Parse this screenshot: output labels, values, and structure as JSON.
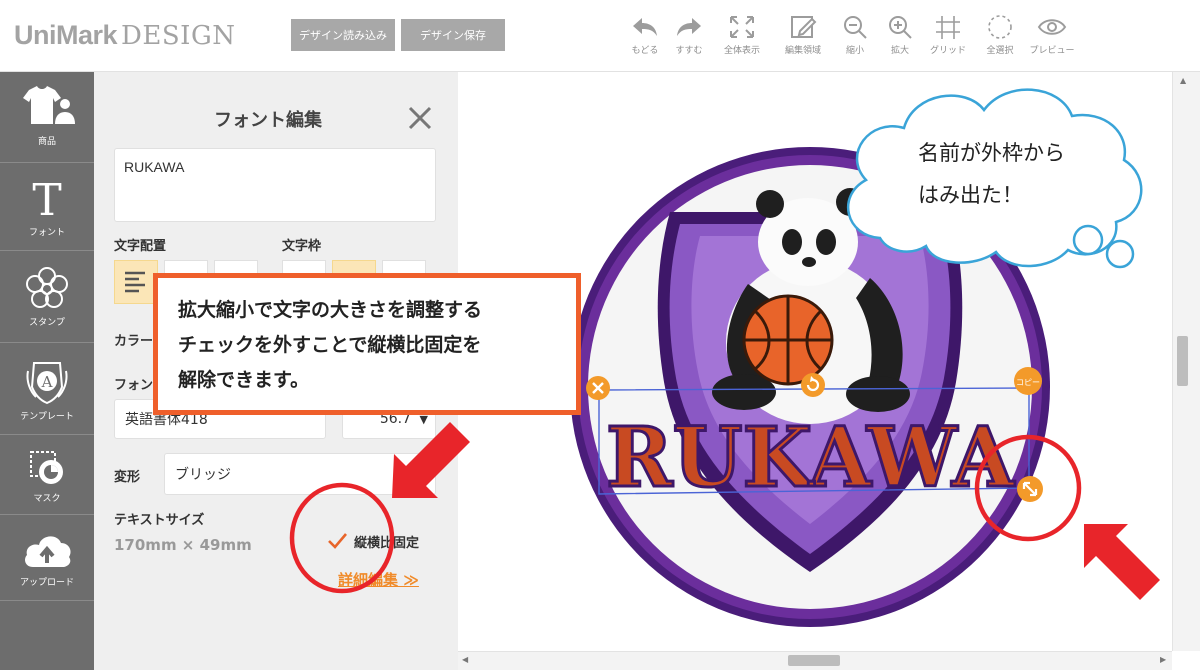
{
  "app": {
    "logo_brand": "UniMark",
    "logo_sub": "DESIGN",
    "load_button": "デザイン読み込み",
    "save_button": "デザイン保存"
  },
  "toolbar": [
    {
      "id": "undo",
      "label": "もどる",
      "icon": "undo-icon"
    },
    {
      "id": "redo",
      "label": "すすむ",
      "icon": "redo-icon"
    },
    {
      "id": "fit",
      "label": "全体表示",
      "icon": "fullscreen-icon"
    },
    {
      "id": "edit-area",
      "label": "編集領域",
      "icon": "edit-area-icon"
    },
    {
      "id": "zoom-out",
      "label": "縮小",
      "icon": "zoom-out-icon"
    },
    {
      "id": "zoom-in",
      "label": "拡大",
      "icon": "zoom-in-icon"
    },
    {
      "id": "grid",
      "label": "グリッド",
      "icon": "grid-icon"
    },
    {
      "id": "select-all",
      "label": "全選択",
      "icon": "select-all-icon"
    },
    {
      "id": "preview",
      "label": "プレビュー",
      "icon": "eye-icon"
    }
  ],
  "sidebar": [
    {
      "id": "product",
      "label": "商品",
      "icon": "apparel-icon"
    },
    {
      "id": "font",
      "label": "フォント",
      "icon": "font-icon"
    },
    {
      "id": "stamp",
      "label": "スタンプ",
      "icon": "flower-icon"
    },
    {
      "id": "template",
      "label": "テンプレート",
      "icon": "emblem-icon"
    },
    {
      "id": "mask",
      "label": "マスク",
      "icon": "mask-icon"
    },
    {
      "id": "upload",
      "label": "アップロード",
      "icon": "cloud-upload-icon"
    }
  ],
  "panel": {
    "title": "フォント編集",
    "text_value": "RUKAWA",
    "align_label": "文字配置",
    "frame_label": "文字枠",
    "color_label": "カラー",
    "font_label": "フォント",
    "font_value": "英語書体418",
    "font_size_value": "56.7",
    "transform_label": "変形",
    "transform_value": "ブリッジ",
    "text_size_label": "テキストサイズ",
    "text_size_value": "170mm × 49mm",
    "aspect_lock_label": "縦横比固定",
    "aspect_lock_checked": true,
    "detail_link": "詳細編集 ≫"
  },
  "canvas": {
    "patch_text": "RUKAWA",
    "copy_handle_label": "コピー",
    "colors": {
      "accent": "#f39a2a",
      "patch_purple": "#6b2e9c",
      "patch_light_purple": "#8a58c4",
      "text_red": "#c84a22"
    }
  },
  "annotations": {
    "callout_lines": [
      "拡大縮小で文字の大きさを調整する",
      "チェックを外すことで縦横比固定を",
      "解除できます。"
    ],
    "cloud_lines": [
      "名前が外枠から",
      "はみ出た！"
    ],
    "colors": {
      "callout_border": "#ef5f2b",
      "marker_red": "#e8252a",
      "cloud_border": "#3aa4d8"
    }
  }
}
